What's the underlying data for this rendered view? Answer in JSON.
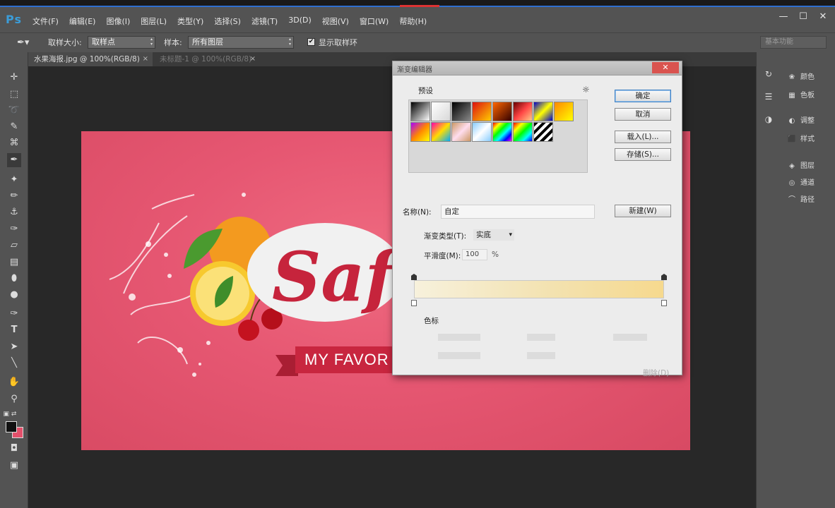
{
  "app": {
    "logo": "Ps"
  },
  "menu": [
    "文件(F)",
    "编辑(E)",
    "图像(I)",
    "图层(L)",
    "类型(Y)",
    "选择(S)",
    "滤镜(T)",
    "3D(D)",
    "视图(V)",
    "窗口(W)",
    "帮助(H)"
  ],
  "window_buttons": [
    "—",
    "☐",
    "✕"
  ],
  "options": {
    "sample_size_label": "取样大小:",
    "sample_size_value": "取样点",
    "sample_label": "样本:",
    "sample_value": "所有图层",
    "show_ring_label": "显示取样环",
    "show_ring_checked": true,
    "workspace": "基本功能"
  },
  "tabs": [
    {
      "label": "水果海报.jpg @ 100%(RGB/8)",
      "close": "×",
      "active": true
    },
    {
      "label": "未标题-1 @ 100%(RGB/8)",
      "close": "×",
      "active": false
    }
  ],
  "tools": [
    "move",
    "marquee",
    "lasso",
    "quick-select",
    "crop",
    "eyedropper",
    "healing",
    "brush",
    "stamp",
    "history-brush",
    "eraser",
    "gradient",
    "blur",
    "dodge",
    "pen",
    "type",
    "path-select",
    "line",
    "hand",
    "zoom"
  ],
  "colors": {
    "foreground": "#111111",
    "background": "#e4506b",
    "canvas_pink": "#e65772",
    "accent_blue": "#2f6fd0"
  },
  "artwork": {
    "script_title": "Saf",
    "banner_text": "MY FAVOR"
  },
  "panels": {
    "right_items": [
      {
        "label": "颜色"
      },
      {
        "label": "色板"
      },
      {
        "label": "调整"
      },
      {
        "label": "样式"
      },
      {
        "label": "图层"
      },
      {
        "label": "通道"
      },
      {
        "label": "路径"
      }
    ]
  },
  "dialog": {
    "title": "渐变编辑器",
    "close": "✕",
    "presets_label": "预设",
    "gear": "☼",
    "buttons": {
      "ok": "确定",
      "cancel": "取消",
      "load": "载入(L)...",
      "save": "存储(S)...",
      "new": "新建(W)"
    },
    "name_label": "名称(N):",
    "name_value": "自定",
    "type_label": "渐变类型(T):",
    "type_value": "实底",
    "smooth_label": "平滑度(M):",
    "smooth_value": "100",
    "smooth_unit": "%",
    "stops_label": "色标",
    "delete_label": "删除(D)"
  }
}
